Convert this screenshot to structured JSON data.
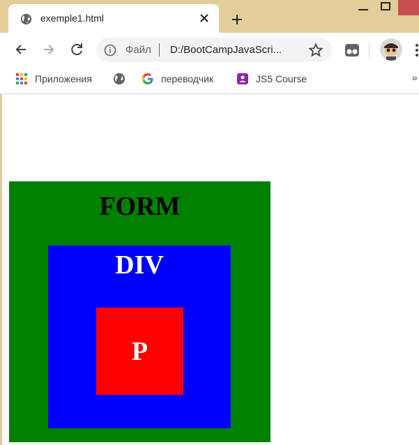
{
  "browser": {
    "tab": {
      "title": "exemple1.html",
      "icon": "globe-icon"
    },
    "address": {
      "prefix": "Файл",
      "url": "D:/BootCampJavaScri..."
    },
    "bookmarks": [
      {
        "label": "Приложения",
        "icon": "apps-grid-icon"
      },
      {
        "label": "",
        "icon": "globe-icon"
      },
      {
        "label": "переводчик",
        "icon": "google-icon"
      },
      {
        "label": "JS5 Course",
        "icon": "classroom-icon"
      }
    ],
    "bookmarks_overflow": "»",
    "colors": {
      "frame": "#e3cd99",
      "omnibox": "#f1f3f4",
      "close": "#c94f4f"
    }
  },
  "page": {
    "form": {
      "label": "FORM",
      "color": "#008000"
    },
    "div": {
      "label": "DIV",
      "color": "#0000ff"
    },
    "p": {
      "label": "P",
      "color": "#ff0000"
    }
  }
}
